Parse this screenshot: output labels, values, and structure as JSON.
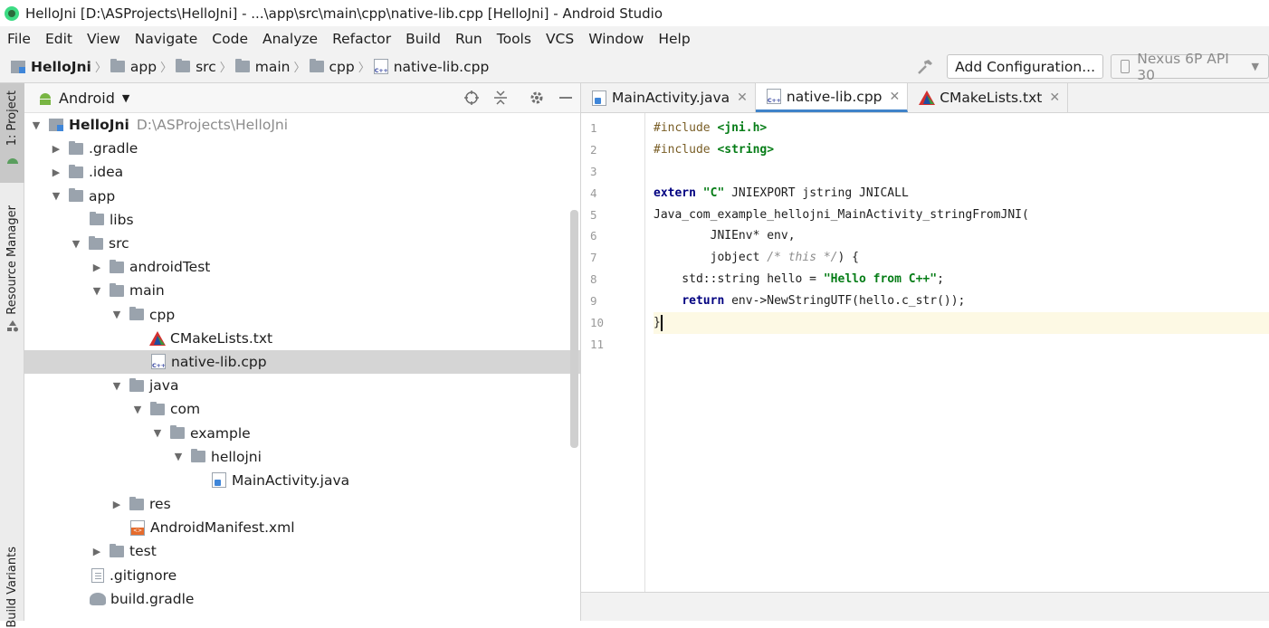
{
  "window": {
    "title": "HelloJni [D:\\ASProjects\\HelloJni] - ...\\app\\src\\main\\cpp\\native-lib.cpp [HelloJni] - Android Studio"
  },
  "menu": [
    "File",
    "Edit",
    "View",
    "Navigate",
    "Code",
    "Analyze",
    "Refactor",
    "Build",
    "Run",
    "Tools",
    "VCS",
    "Window",
    "Help"
  ],
  "breadcrumb": [
    "HelloJni",
    "app",
    "src",
    "main",
    "cpp",
    "native-lib.cpp"
  ],
  "toolbar": {
    "add_config_label": "Add Configuration...",
    "device_label": "Nexus 6P API 30"
  },
  "side_tabs": {
    "project": "1: Project",
    "resource_manager": "Resource Manager",
    "build_variants": "Build Variants"
  },
  "project_panel": {
    "view_mode": "Android"
  },
  "tree": [
    {
      "label": "HelloJni",
      "extra": "D:\\ASProjects\\HelloJni",
      "icon": "module-icon",
      "depth": 0,
      "expanded": true
    },
    {
      "label": ".gradle",
      "icon": "folder-icon",
      "depth": 1,
      "expanded": false
    },
    {
      "label": ".idea",
      "icon": "folder-icon",
      "depth": 1,
      "expanded": false
    },
    {
      "label": "app",
      "icon": "folder-icon",
      "depth": 1,
      "expanded": true
    },
    {
      "label": "libs",
      "icon": "folder-icon",
      "depth": 2
    },
    {
      "label": "src",
      "icon": "folder-icon",
      "depth": 2,
      "expanded": true
    },
    {
      "label": "androidTest",
      "icon": "folder-icon",
      "depth": 3,
      "expanded": false
    },
    {
      "label": "main",
      "icon": "folder-icon",
      "depth": 3,
      "expanded": true
    },
    {
      "label": "cpp",
      "icon": "folder-icon",
      "depth": 4,
      "expanded": true
    },
    {
      "label": "CMakeLists.txt",
      "icon": "cmake-icon",
      "depth": 5
    },
    {
      "label": "native-lib.cpp",
      "icon": "cpp-file-icon",
      "depth": 5,
      "selected": true
    },
    {
      "label": "java",
      "icon": "folder-icon",
      "depth": 4,
      "expanded": true
    },
    {
      "label": "com",
      "icon": "folder-icon",
      "depth": 5,
      "expanded": true
    },
    {
      "label": "example",
      "icon": "folder-icon",
      "depth": 6,
      "expanded": true
    },
    {
      "label": "hellojni",
      "icon": "folder-icon",
      "depth": 7,
      "expanded": true
    },
    {
      "label": "MainActivity.java",
      "icon": "java-file-icon",
      "depth": 8
    },
    {
      "label": "res",
      "icon": "folder-icon",
      "depth": 4,
      "expanded": false
    },
    {
      "label": "AndroidManifest.xml",
      "icon": "xml-file-icon",
      "depth": 4
    },
    {
      "label": "test",
      "icon": "folder-icon",
      "depth": 3,
      "expanded": false
    },
    {
      "label": ".gitignore",
      "icon": "text-file-icon",
      "depth": 2
    },
    {
      "label": "build.gradle",
      "icon": "gradle-icon",
      "depth": 2
    }
  ],
  "editor_tabs": [
    {
      "label": "MainActivity.java",
      "icon": "java-file-icon",
      "active": false
    },
    {
      "label": "native-lib.cpp",
      "icon": "cpp-file-icon",
      "active": true
    },
    {
      "label": "CMakeLists.txt",
      "icon": "cmake-icon",
      "active": false
    }
  ],
  "line_numbers": [
    "1",
    "2",
    "3",
    "4",
    "5",
    "6",
    "7",
    "8",
    "9",
    "10",
    "11"
  ],
  "code": {
    "l1_pp": "#include ",
    "l1_str": "<jni.h>",
    "l2_pp": "#include ",
    "l2_str": "<string>",
    "l4_kw": "extern ",
    "l4_str": "\"C\"",
    "l4_rest": " JNIEXPORT jstring JNICALL",
    "l5": "Java_com_example_hellojni_MainActivity_stringFromJNI(",
    "l6": "        JNIEnv* env,",
    "l7_a": "        jobject ",
    "l7_cmt": "/* this */",
    "l7_b": ") {",
    "l8_a": "    std::string hello = ",
    "l8_str": "\"Hello from C++\"",
    "l8_b": ";",
    "l9_a": "    ",
    "l9_kw": "return",
    "l9_b": " env->NewStringUTF(hello.c_str());",
    "l10": "}"
  },
  "colors": {
    "accent": "#4083c9",
    "selection": "#d5d5d5",
    "current_line": "#fdf9e4"
  }
}
